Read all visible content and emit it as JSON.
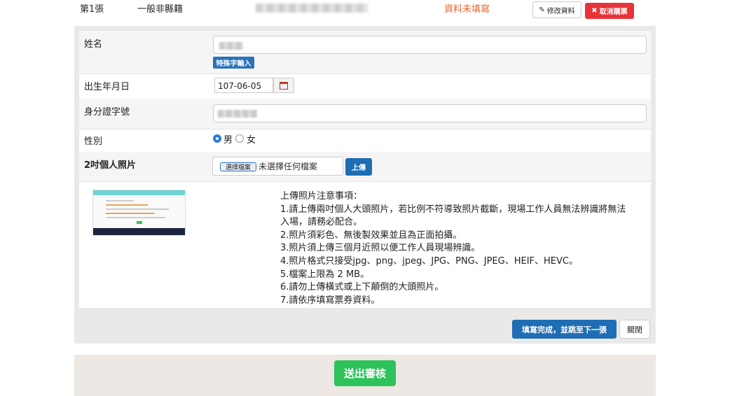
{
  "header": {
    "ticket_no": "第1張",
    "ticket_type": "一般非縣籍",
    "status": "資料未填寫",
    "edit_label": "修改資料",
    "cancel_label": "取消購票",
    "colors": {
      "status": "#e8632b",
      "cancel": "#e8333a"
    }
  },
  "form": {
    "name": {
      "label": "姓名",
      "special_input_label": "特殊字輸入"
    },
    "birthdate": {
      "label": "出生年月日",
      "value": "107-06-05"
    },
    "id_number": {
      "label": "身分證字號"
    },
    "gender": {
      "label": "性別",
      "options": [
        "男",
        "女"
      ],
      "selected": "男"
    },
    "photo": {
      "label": "2吋個人照片",
      "file_button": "選擇檔案",
      "file_status": "未選擇任何檔案",
      "upload_label": "上傳"
    }
  },
  "notes": {
    "lines": [
      "上傳照片注意事項：",
      "1.請上傳兩吋個人大頭照片，若比例不符導致照片截斷，現場工作人員無法辨識將無法",
      "入場，請務必配合。",
      "2.照片須彩色、無後製效果並且為正面拍攝。",
      "3.照片須上傳三個月近照以便工作人員現場辨識。",
      "4.照片格式只接受jpg、png、jpeg、JPG、PNG、JPEG、HEIF、HEVC。",
      "5.檔案上限為 2 MB。",
      "6.請勿上傳橫式或上下顛倒的大頭照片。",
      "7.請依序填寫票券資料。"
    ]
  },
  "actions": {
    "next_label": "填寫完成，並跳至下一張",
    "close_label": "關閉",
    "submit_label": "送出審核",
    "colors": {
      "primary": "#1f6eb5",
      "submit": "#2ec25b"
    }
  }
}
